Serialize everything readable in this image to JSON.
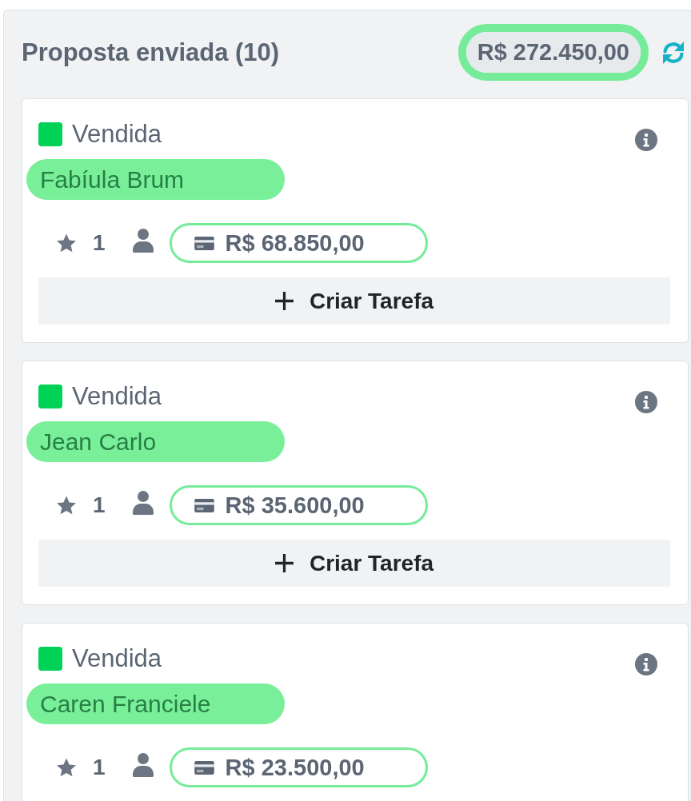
{
  "column": {
    "title": "Proposta enviada (10)",
    "total": {
      "value": "R$ 272.450,00",
      "highlighted": true
    }
  },
  "cards": [
    {
      "status": {
        "label": "Vendida",
        "color": "#00d157"
      },
      "name": {
        "text": "Fabíula Brum",
        "highlighted": true
      },
      "rating": "1",
      "amount": {
        "value": "R$ 68.850,00",
        "highlighted": true
      },
      "button": "Criar Tarefa"
    },
    {
      "status": {
        "label": "Vendida",
        "color": "#00d157"
      },
      "name": {
        "text": "Jean Carlo",
        "highlighted": true
      },
      "rating": "1",
      "amount": {
        "value": "R$ 35.600,00",
        "highlighted": true
      },
      "button": "Criar Tarefa"
    },
    {
      "status": {
        "label": "Vendida",
        "color": "#00d157"
      },
      "name": {
        "text": "Caren Franciele",
        "highlighted": true
      },
      "rating": "1",
      "amount": {
        "value": "R$ 23.500,00",
        "highlighted": true
      }
    }
  ]
}
